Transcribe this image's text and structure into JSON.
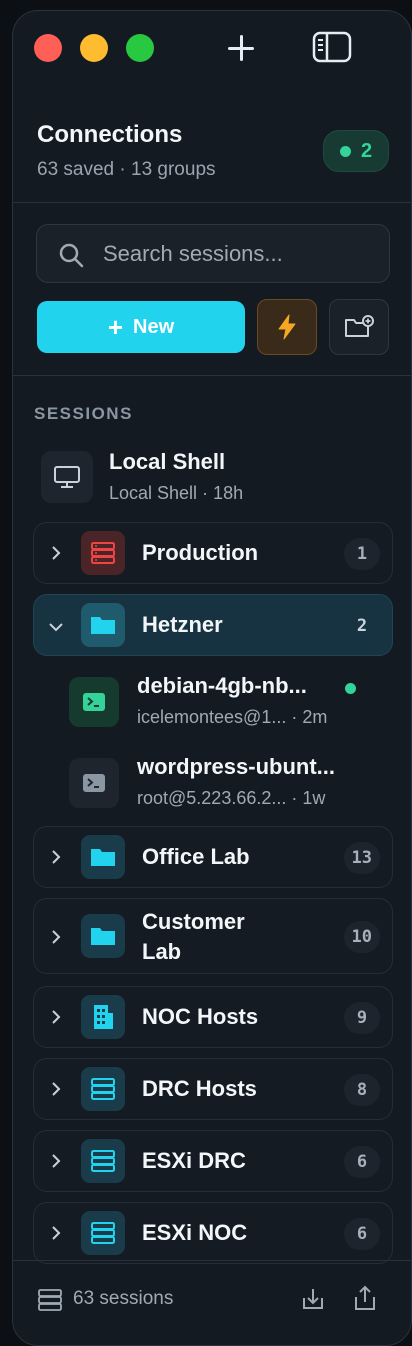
{
  "header": {
    "title": "Connections",
    "subtitle": "63 saved · 13 groups",
    "online_count": "2"
  },
  "search": {
    "placeholder": "Search sessions..."
  },
  "actions": {
    "new_label": "New"
  },
  "section_label": "SESSIONS",
  "local_shell": {
    "title": "Local Shell",
    "subtitle": "Local Shell · 18h"
  },
  "groups": [
    {
      "label": "Production",
      "count": "1",
      "icon": "server-icon",
      "color": "#ef4444",
      "expanded": false
    },
    {
      "label": "Hetzner",
      "count": "2",
      "icon": "folder-icon",
      "color": "#22d3ee",
      "expanded": true
    },
    {
      "label": "Office Lab",
      "count": "13",
      "icon": "folder-icon",
      "color": "#22d3ee",
      "expanded": false
    },
    {
      "label": "Customer Lab",
      "count": "10",
      "icon": "folder-icon",
      "color": "#22d3ee",
      "expanded": false
    },
    {
      "label": "NOC Hosts",
      "count": "9",
      "icon": "building-icon",
      "color": "#22d3ee",
      "expanded": false
    },
    {
      "label": "DRC Hosts",
      "count": "8",
      "icon": "server-icon",
      "color": "#22d3ee",
      "expanded": false
    },
    {
      "label": "ESXi DRC",
      "count": "6",
      "icon": "server-icon",
      "color": "#22d3ee",
      "expanded": false
    },
    {
      "label": "ESXi NOC",
      "count": "6",
      "icon": "server-icon",
      "color": "#22d3ee",
      "expanded": false
    }
  ],
  "hetzner_sessions": [
    {
      "name": "debian-4gb-nb...",
      "meta": "icelemontees@1... · 2m",
      "online": true
    },
    {
      "name": "wordpress-ubunt...",
      "meta": "root@5.223.66.2... · 1w",
      "online": false
    }
  ],
  "footer": {
    "sessions_label": "63 sessions"
  },
  "colors": {
    "accent": "#22d3ee",
    "online": "#34d399",
    "danger": "#ef4444",
    "lightning": "#f5a623"
  }
}
